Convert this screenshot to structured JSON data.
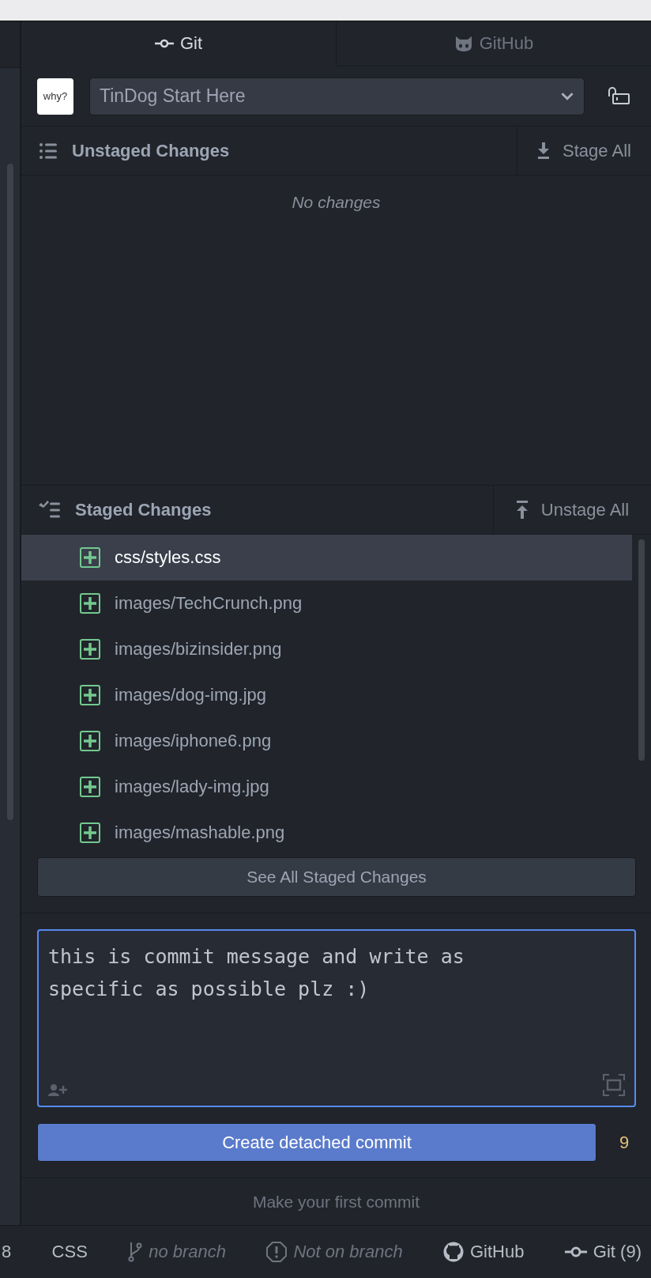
{
  "tabs": [
    {
      "label": "Git",
      "kind": "git",
      "selected": true
    },
    {
      "label": "GitHub",
      "kind": "github",
      "selected": false
    }
  ],
  "repo": {
    "avatar_text": "why?",
    "name": "TinDog Start Here"
  },
  "unstaged": {
    "title": "Unstaged Changes",
    "action": "Stage All",
    "empty_text": "No changes"
  },
  "staged": {
    "title": "Staged Changes",
    "action": "Unstage All",
    "files": [
      {
        "path": "css/styles.css",
        "selected": true
      },
      {
        "path": "images/TechCrunch.png",
        "selected": false
      },
      {
        "path": "images/bizinsider.png",
        "selected": false
      },
      {
        "path": "images/dog-img.jpg",
        "selected": false
      },
      {
        "path": "images/iphone6.png",
        "selected": false
      },
      {
        "path": "images/lady-img.jpg",
        "selected": false
      },
      {
        "path": "images/mashable.png",
        "selected": false
      }
    ]
  },
  "see_all": "See All Staged Changes",
  "commit": {
    "message": "this is commit message and write as\nspecific as possible plz :)",
    "button": "Create detached commit",
    "remaining": "9"
  },
  "footer_text": "Make your first commit",
  "status_bar": [
    {
      "kind": "text",
      "label": "8"
    },
    {
      "kind": "text",
      "label": "CSS"
    },
    {
      "kind": "branch",
      "label": "no branch"
    },
    {
      "kind": "warning",
      "label": "Not on branch"
    },
    {
      "kind": "github",
      "label": "GitHub"
    },
    {
      "kind": "git",
      "label": "Git (9)"
    }
  ]
}
